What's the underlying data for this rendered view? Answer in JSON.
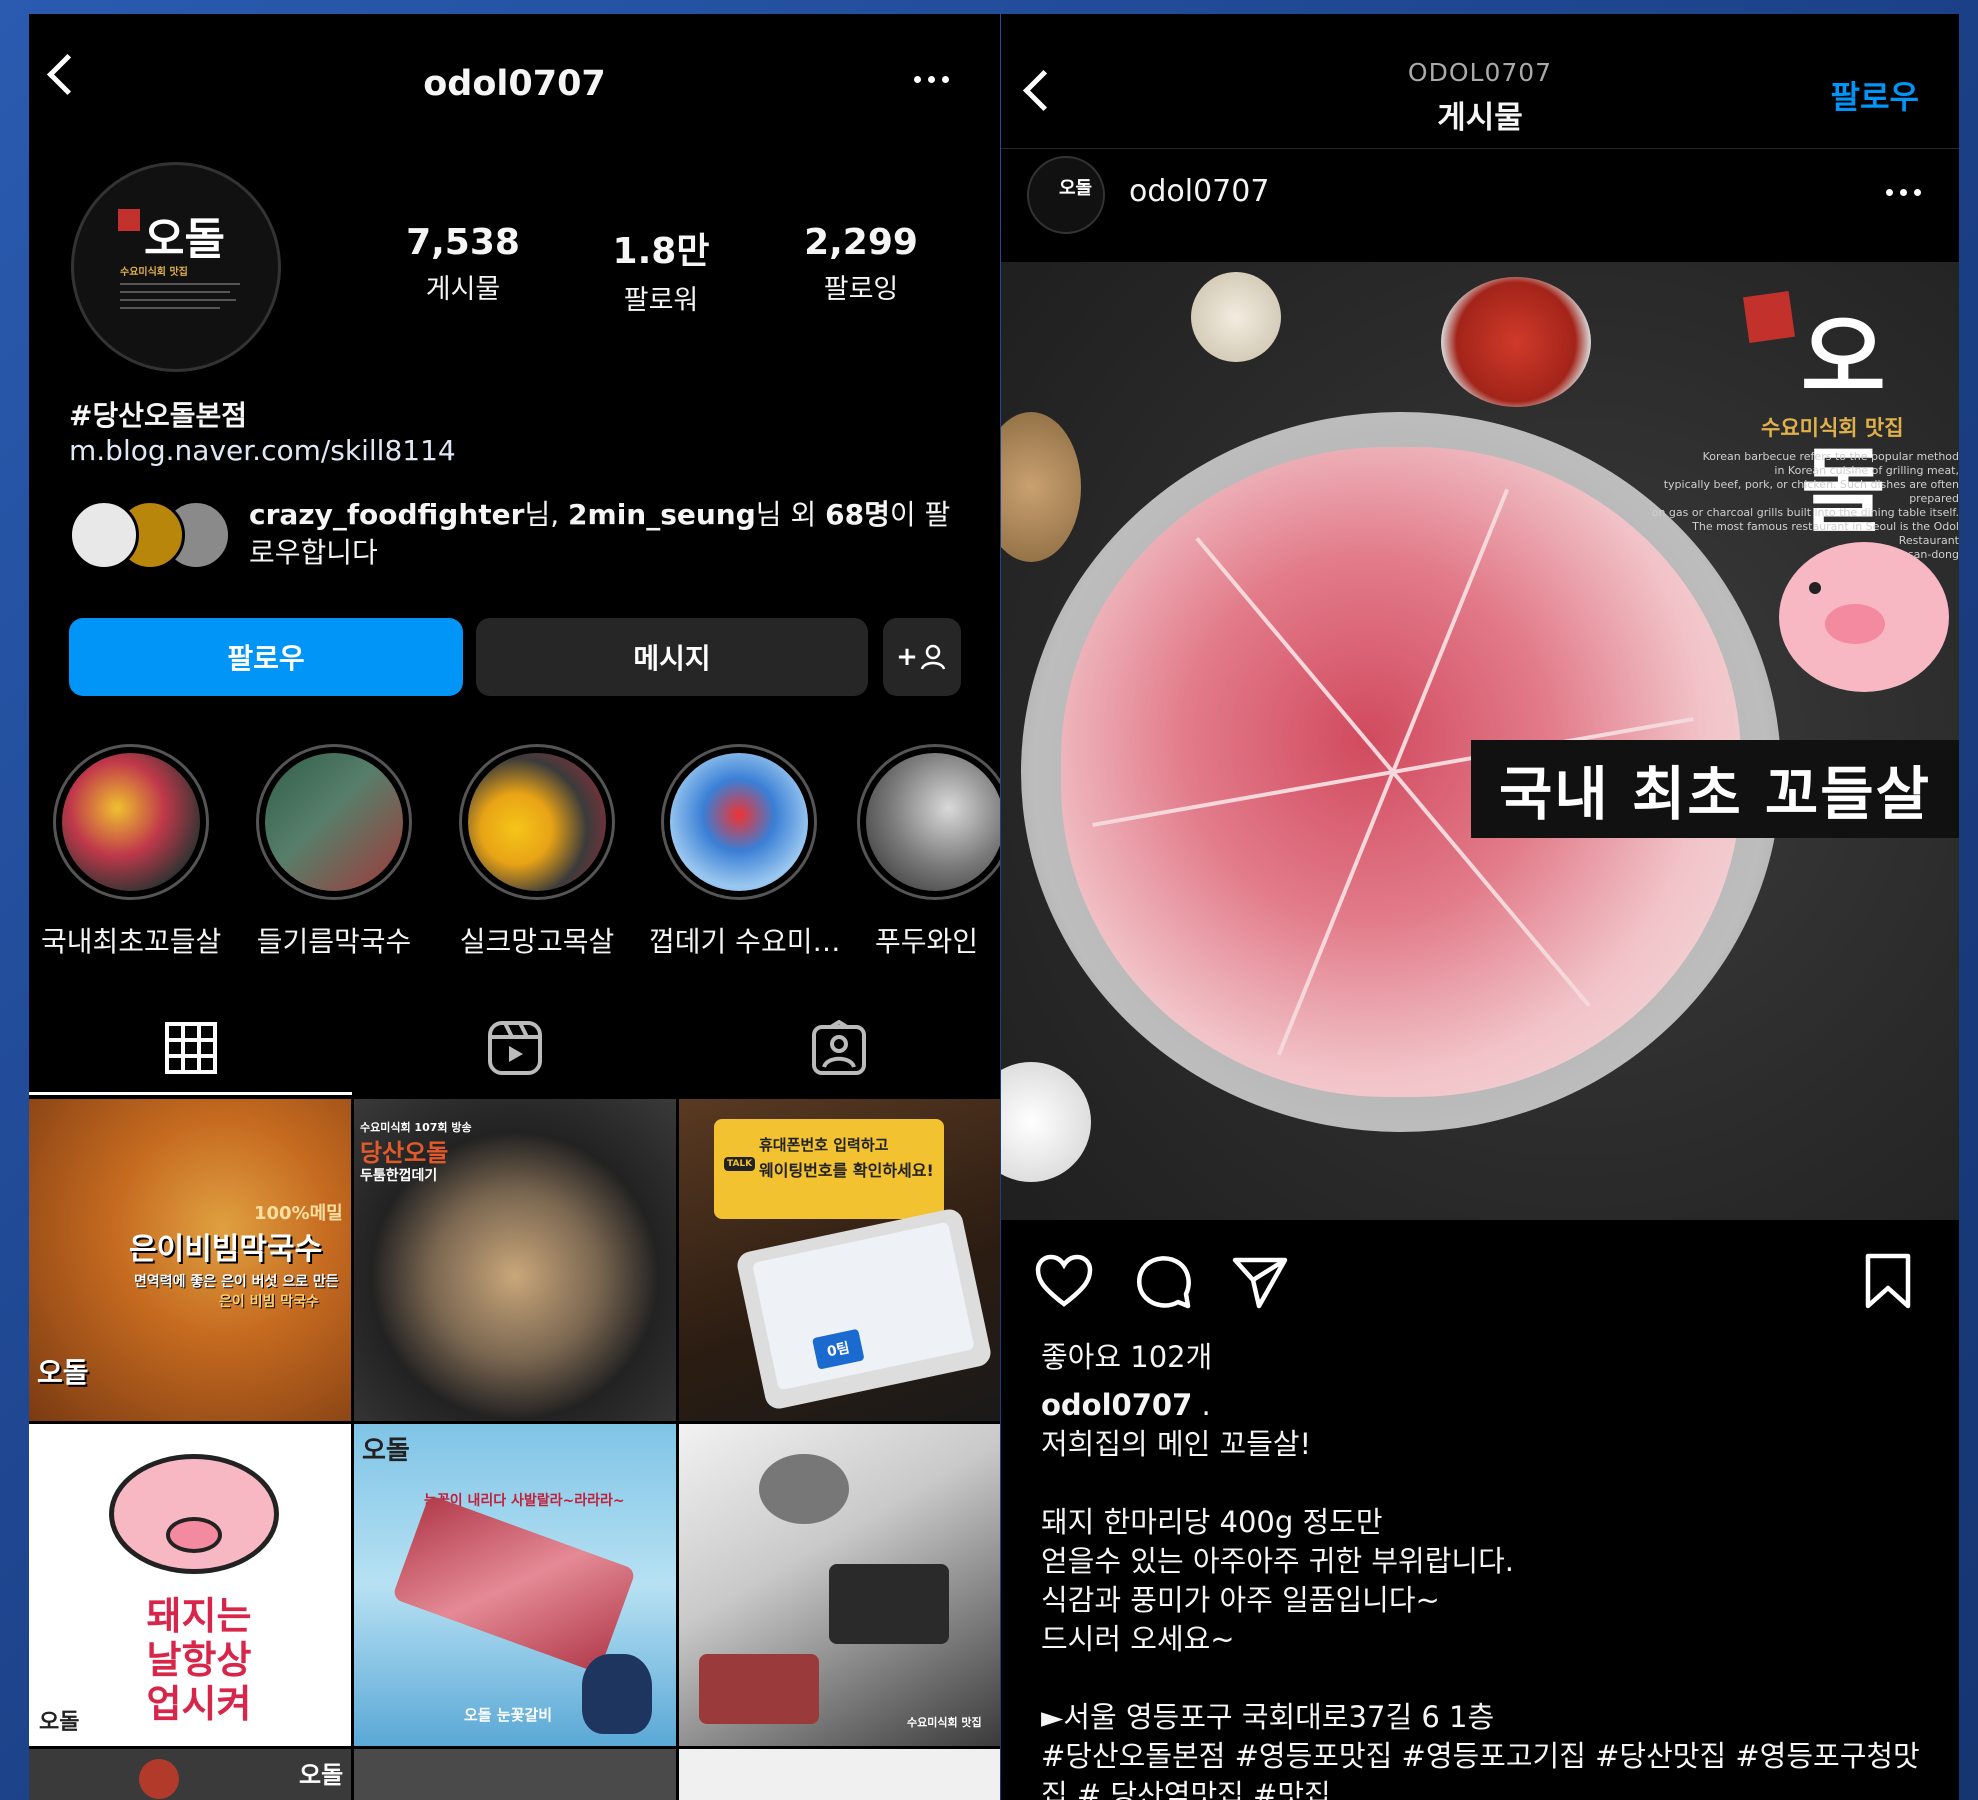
{
  "profile": {
    "username": "odol0707",
    "stats": [
      {
        "value": "7,538",
        "label": "게시물"
      },
      {
        "value": "1.8만",
        "label": "팔로워"
      },
      {
        "value": "2,299",
        "label": "팔로잉"
      }
    ],
    "bio_name": "#당산오돌본점",
    "bio_link": "m.blog.naver.com/skill8114",
    "mutual_user1": "crazy_foodfighter",
    "mutual_nim1": "님, ",
    "mutual_user2": "2min_seung",
    "mutual_nim2": "님 외 ",
    "mutual_count": "68명",
    "mutual_suffix": "이 팔로우합니다",
    "buttons": {
      "follow": "팔로우",
      "message": "메시지",
      "add": "+"
    },
    "highlights": [
      "국내최초꼬들살",
      "들기름막국수",
      "실크망고목살",
      "껍데기 수요미…",
      "푸두와인"
    ],
    "avatar_logo": "오돌",
    "avatar_tagline": "수요미식회 맛집",
    "grid": {
      "c1_top": "100%메밀",
      "c1_mid": "은이비빔막국수",
      "c1_sub": "면역력에 좋은 은이 버섯 으로 만든",
      "c1_sub2": "은이 비빔 막국수",
      "c1_logo": "오돌",
      "c2_top": "수요미식회 107회 방송",
      "c2_mid": "당산오돌",
      "c2_sub": "두툼한껍데기",
      "c3_top": "휴대폰번호 입력하고",
      "c3_mid": "웨이팅번호를 확인하세요!",
      "c3_tag": "TALK",
      "c3_screen": "0팀",
      "c4_text": "돼지는 날항상 업시켜",
      "c4_logo": "오돌",
      "c5_logo": "오돌",
      "c5_top": "눈꽃이 내리다 사발랄라~라라라~",
      "c5_bottom": "오돌 눈꽃갈비",
      "c6_logo": "수요미식회 맛집",
      "c7_logo": "오돌"
    }
  },
  "post": {
    "header_sub": "ODOL0707",
    "header_title": "게시물",
    "follow": "팔로우",
    "username": "odol0707",
    "image_logo": "오돌",
    "image_tagline": "수요미식회 맛집",
    "image_small1": "Korean barbecue refers to the popular method",
    "image_small2": "in Korean cuisine of grilling meat,",
    "image_small3": "typically beef, pork, or chicken. Such dishes are often prepared",
    "image_small4": "on gas or charcoal grills built into the dining table itself.",
    "image_small5": "The most famous restaurant in Seoul is the Odol Restaurant",
    "image_small6": "in Dangsan-dong",
    "banner_text": "국내 최초 꼬들살",
    "likes": "좋아요 102개",
    "caption_user": "odol0707",
    "caption_body": " .\n저희집의 메인 꼬들살!\n\n돼지 한마리당 400g 정도만\n얻을수 있는 아주아주 귀한 부위랍니다.\n식감과 풍미가 아주 일품입니다~\n드시러 오세요~\n\n►서울 영등포구 국회대로37길 6 1층\n#당산오돌본점 #영등포맛집 #영등포고기집 #당산맛집 #영등포구청맛집 # 당산역맛집 #맛집"
  },
  "colors": {
    "accent": "#0095f6",
    "background": "#000000",
    "button_dark": "#262626"
  }
}
